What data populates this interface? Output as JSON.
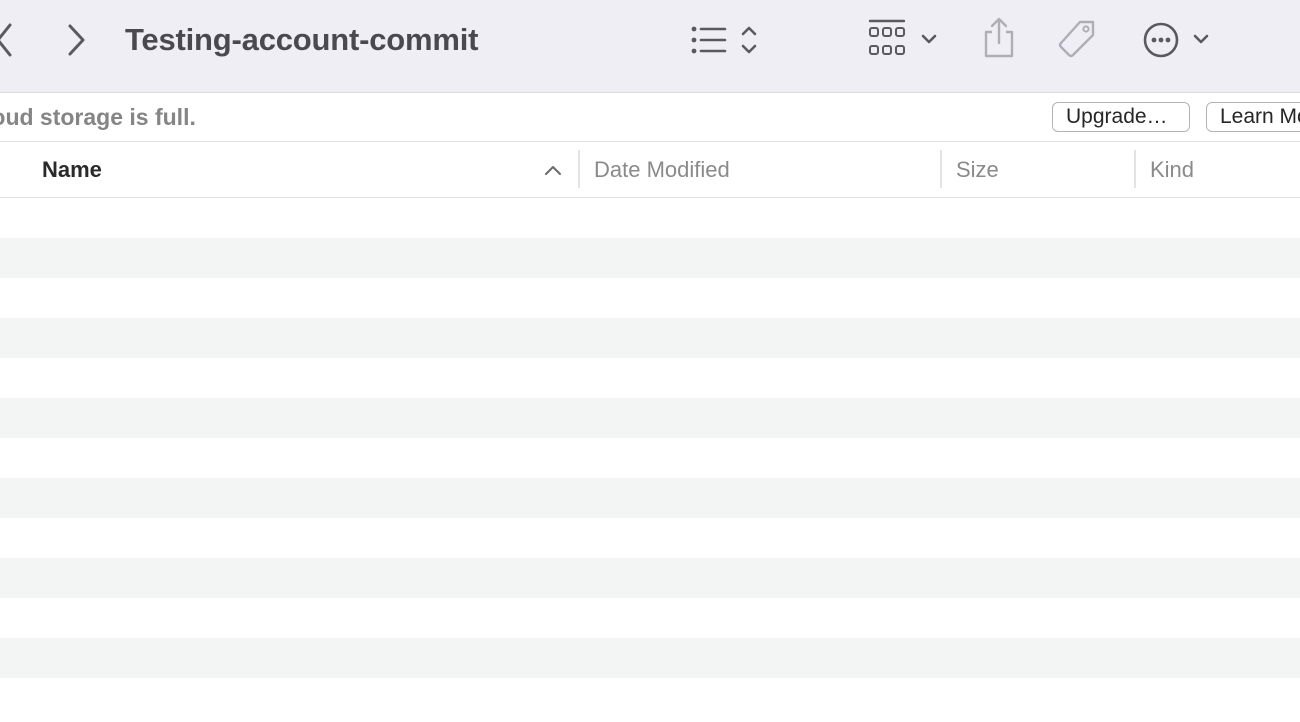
{
  "window": {
    "title": "Testing-account-commit"
  },
  "toolbar": {
    "back_icon": "chevron-left-icon",
    "forward_icon": "chevron-right-icon",
    "view_icon": "list-view-icon",
    "group_icon": "group-grid-icon",
    "share_icon": "share-icon",
    "tag_icon": "tag-icon",
    "more_icon": "ellipsis-circle-icon"
  },
  "banner": {
    "message": "iCloud storage is full.",
    "upgrade_label": "Upgrade…",
    "learn_more_label": "Learn More…"
  },
  "columns": [
    {
      "label": "Name",
      "sorted": true,
      "sort_direction": "ascending"
    },
    {
      "label": "Date Modified"
    },
    {
      "label": "Size"
    },
    {
      "label": "Kind"
    }
  ],
  "rows": [],
  "colors": {
    "toolbar_bg": "#f0eef5",
    "alt_row_bg": "#f3f4f4",
    "icon": "#5a5a5e",
    "icon_disabled": "#b0aeb5"
  }
}
